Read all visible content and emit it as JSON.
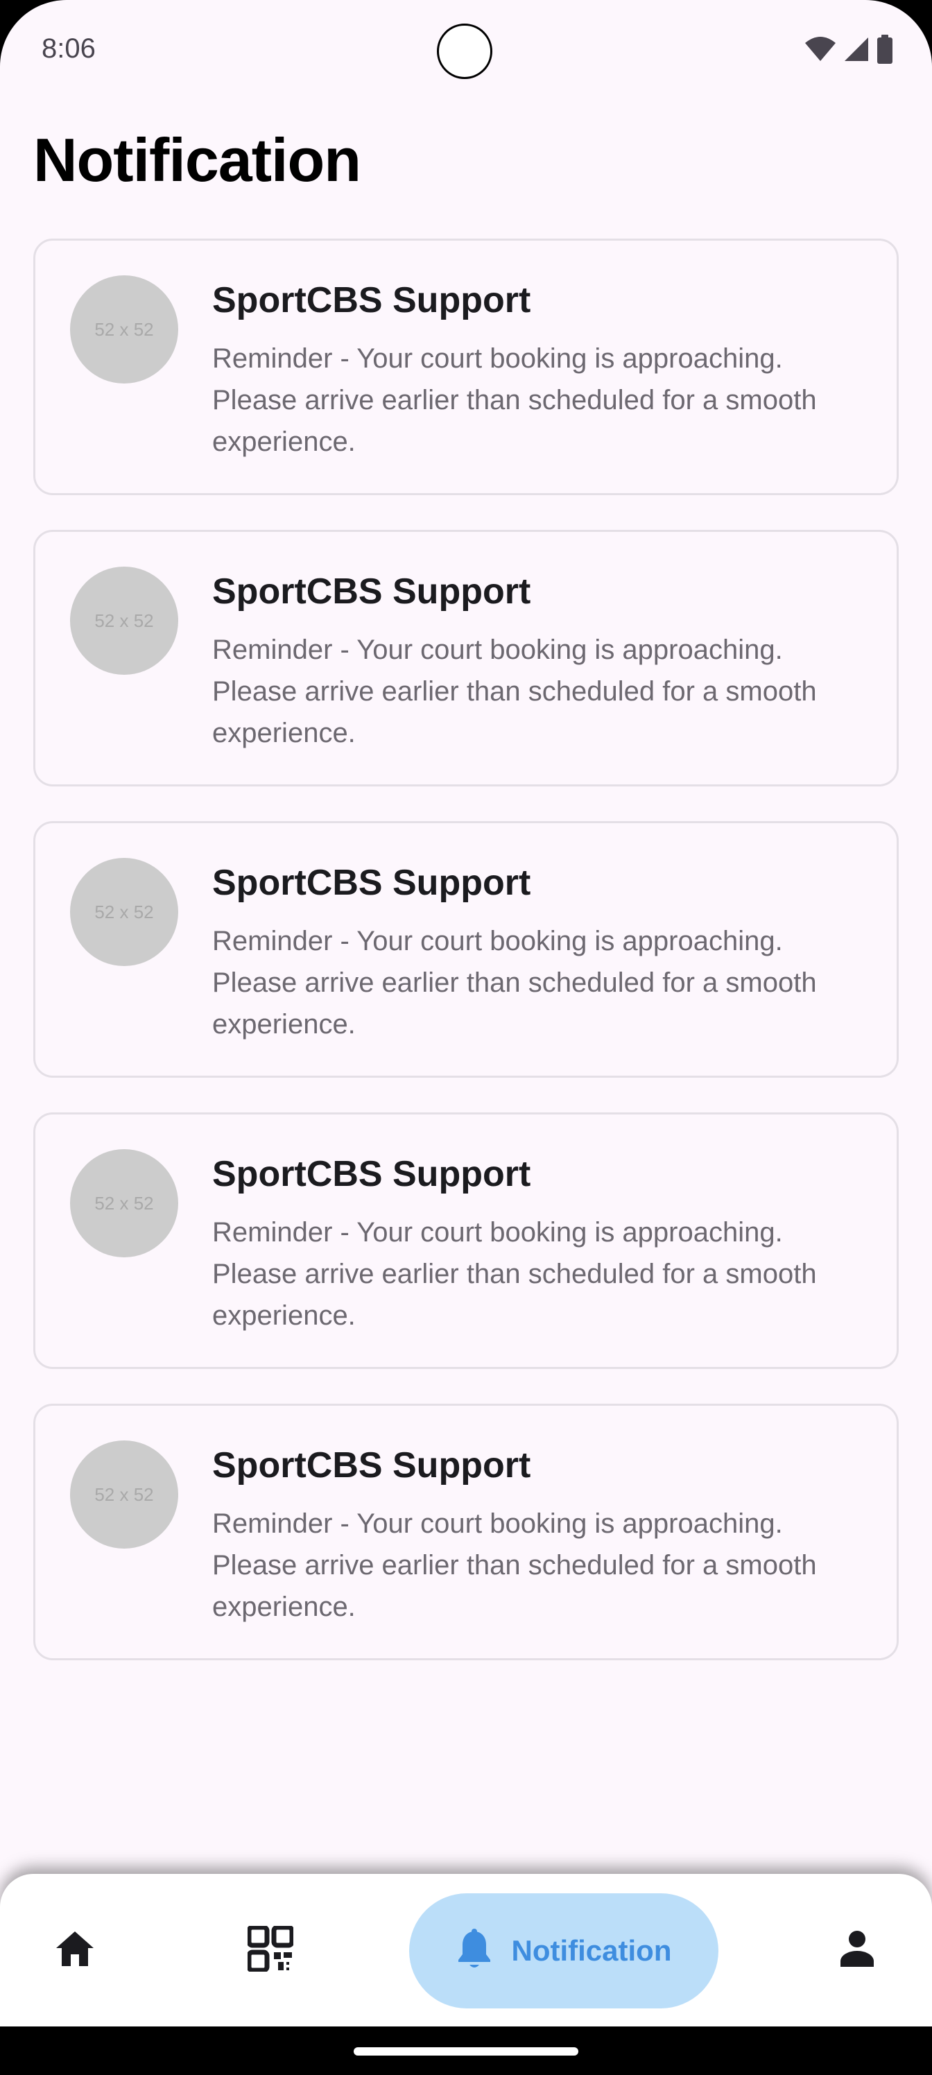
{
  "status_bar": {
    "time": "8:06",
    "icons": [
      "wifi-icon",
      "signal-icon",
      "battery-icon"
    ]
  },
  "page": {
    "title": "Notification"
  },
  "notifications": [
    {
      "avatar_placeholder": "52 x 52",
      "title": "SportCBS Support",
      "body": "Reminder - Your court booking is approaching. Please arrive earlier than scheduled for a smooth experience."
    },
    {
      "avatar_placeholder": "52 x 52",
      "title": "SportCBS Support",
      "body": "Reminder - Your court booking is approaching. Please arrive earlier than scheduled for a smooth experience."
    },
    {
      "avatar_placeholder": "52 x 52",
      "title": "SportCBS Support",
      "body": "Reminder - Your court booking is approaching. Please arrive earlier than scheduled for a smooth experience."
    },
    {
      "avatar_placeholder": "52 x 52",
      "title": "SportCBS Support",
      "body": "Reminder - Your court booking is approaching. Please arrive earlier than scheduled for a smooth experience."
    },
    {
      "avatar_placeholder": "52 x 52",
      "title": "SportCBS Support",
      "body": "Reminder - Your court booking is approaching. Please arrive earlier than scheduled for a smooth experience."
    }
  ],
  "bottom_nav": {
    "items": [
      {
        "icon": "home-icon"
      },
      {
        "icon": "qr-code-icon"
      },
      {
        "icon": "bell-icon",
        "label": "Notification",
        "selected": true
      },
      {
        "icon": "person-icon"
      }
    ],
    "colors": {
      "selected_background": "#bbdef9",
      "selected_foreground": "#3e8ddf",
      "icon": "#1b1b1f"
    }
  }
}
